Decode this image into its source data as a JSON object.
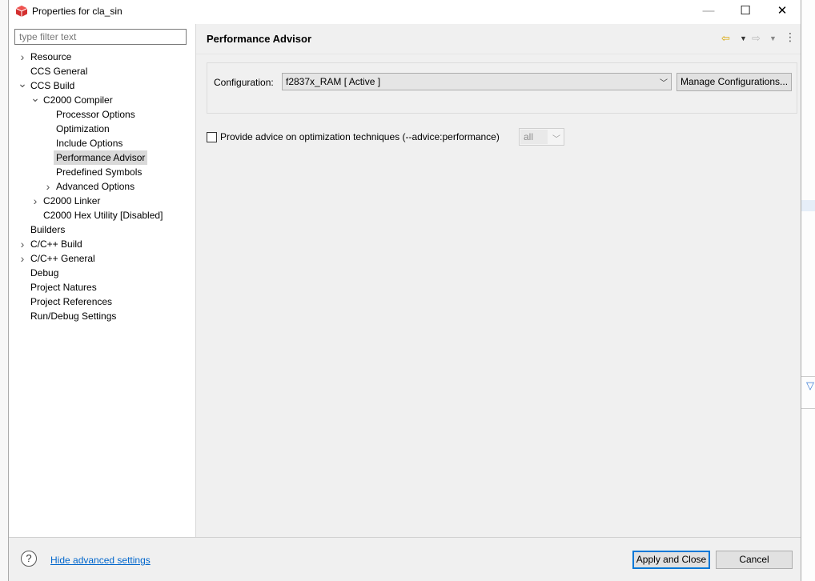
{
  "window": {
    "title": "Properties for cla_sin",
    "minimize_glyph": "—",
    "maximize_glyph": "☐",
    "close_glyph": "✕"
  },
  "filter": {
    "placeholder": "type filter text",
    "value": ""
  },
  "tree": [
    {
      "label": "Resource",
      "depth": 0,
      "expander": "collapsed"
    },
    {
      "label": "CCS General",
      "depth": 0,
      "expander": "none"
    },
    {
      "label": "CCS Build",
      "depth": 0,
      "expander": "expanded"
    },
    {
      "label": "C2000 Compiler",
      "depth": 1,
      "expander": "expanded"
    },
    {
      "label": "Processor Options",
      "depth": 2,
      "expander": "none"
    },
    {
      "label": "Optimization",
      "depth": 2,
      "expander": "none"
    },
    {
      "label": "Include Options",
      "depth": 2,
      "expander": "none"
    },
    {
      "label": "Performance Advisor",
      "depth": 2,
      "expander": "none",
      "selected": true
    },
    {
      "label": "Predefined Symbols",
      "depth": 2,
      "expander": "none"
    },
    {
      "label": "Advanced Options",
      "depth": 2,
      "expander": "collapsed"
    },
    {
      "label": "C2000 Linker",
      "depth": 1,
      "expander": "collapsed"
    },
    {
      "label": "C2000 Hex Utility  [Disabled]",
      "depth": 1,
      "expander": "none"
    },
    {
      "label": "Builders",
      "depth": 0,
      "expander": "none"
    },
    {
      "label": "C/C++ Build",
      "depth": 0,
      "expander": "collapsed"
    },
    {
      "label": "C/C++ General",
      "depth": 0,
      "expander": "collapsed"
    },
    {
      "label": "Debug",
      "depth": 0,
      "expander": "none"
    },
    {
      "label": "Project Natures",
      "depth": 0,
      "expander": "none"
    },
    {
      "label": "Project References",
      "depth": 0,
      "expander": "none"
    },
    {
      "label": "Run/Debug Settings",
      "depth": 0,
      "expander": "none"
    }
  ],
  "page": {
    "title": "Performance Advisor",
    "icons": {
      "back": "back-arrow-icon",
      "forward": "forward-arrow-icon",
      "menu": "view-menu-icon"
    },
    "configuration": {
      "label": "Configuration:",
      "value": "f2837x_RAM  [ Active ]",
      "manage_label": "Manage Configurations..."
    },
    "advice": {
      "label": "Provide advice on optimization techniques (--advice:performance)",
      "checked": false,
      "select_value": "all"
    }
  },
  "footer": {
    "help_glyph": "?",
    "hide_link": "Hide advanced settings",
    "apply_label": "Apply and Close",
    "cancel_label": "Cancel"
  },
  "colors": {
    "dialog_bg": "#f0f0f0",
    "selection": "#d9d9d9",
    "link": "#0066cc",
    "default_button_border": "#0078d7",
    "app_icon": "#d32f2f"
  }
}
